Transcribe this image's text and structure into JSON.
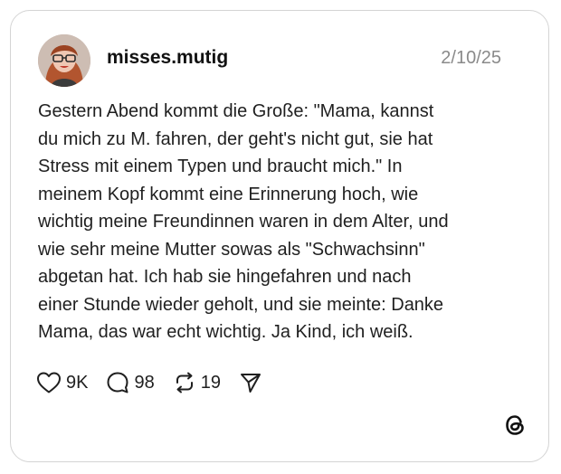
{
  "post": {
    "username": "misses.mutig",
    "date": "2/10/25",
    "text": "Gestern Abend kommt die Große: \"Mama, kannst\ndu mich zu M. fahren, der geht's nicht gut, sie hat\nStress mit einem Typen und braucht mich.\" In\nmeinem Kopf kommt eine Erinnerung hoch, wie\nwichtig meine Freundinnen waren in dem Alter, und\nwie sehr meine Mutter sowas als \"Schwachsinn\"\nabgetan hat. Ich hab sie hingefahren und nach\neiner Stunde wieder geholt, und sie meinte: Danke\nMama, das war echt wichtig. Ja Kind, ich weiß."
  },
  "actions": {
    "likes": "9K",
    "replies": "98",
    "reposts": "19"
  },
  "icons": {
    "like": "heart-icon",
    "reply": "speech-bubble-icon",
    "repost": "repost-icon",
    "share": "send-icon",
    "brand": "threads-logo-icon"
  },
  "colors": {
    "text": "#1f1f1f",
    "muted": "#8a8a8a",
    "border": "#d4d4d4"
  }
}
